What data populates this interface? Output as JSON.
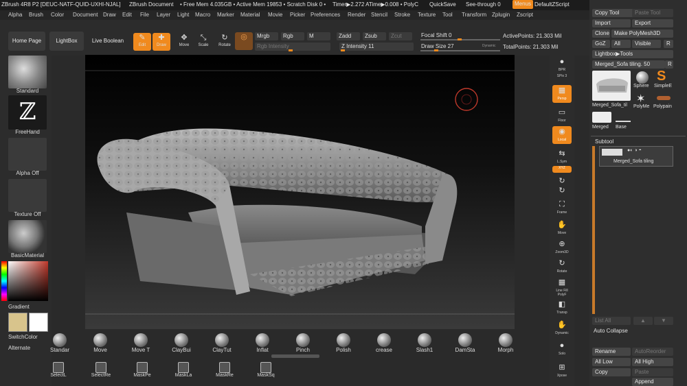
{
  "titlebar": {
    "app": "ZBrush 4R8 P2 [DEUC-NATF-QUID-UXHI-NJAL]",
    "doc": "ZBrush Document",
    "mem": "• Free Mem 4.035GB • Active Mem 19853 • Scratch Disk 0 •",
    "timer": "Timer▶2.272 ATime▶0.008 • PolyC",
    "quicksave": "QuickSave",
    "seethrough": "See-through  0",
    "menus": "Menus",
    "script": "DefaultZScript"
  },
  "menubar": [
    "Alpha",
    "Brush",
    "Color",
    "Document",
    "Draw",
    "Edit",
    "File",
    "Layer",
    "Light",
    "Macro",
    "Marker",
    "Material",
    "Movie",
    "Picker",
    "Preferences",
    "Render",
    "Stencil",
    "Stroke",
    "Texture",
    "Tool",
    "Transform",
    "Zplugin",
    "Zscript"
  ],
  "topshelf": {
    "home": "Home Page",
    "lightbox": "LightBox",
    "liveboolean": "Live Boolean",
    "tools": [
      {
        "label": "Edit",
        "icon": "✎"
      },
      {
        "label": "Draw",
        "icon": "✚"
      },
      {
        "label": "Move",
        "icon": "✥"
      },
      {
        "label": "Scale",
        "icon": "⤡"
      },
      {
        "label": "Rotate",
        "icon": "↻"
      }
    ],
    "mrgb": "Mrgb",
    "rgb": "Rgb",
    "m": "M",
    "zadd": "Zadd",
    "zsub": "Zsub",
    "zcut": "Zcut",
    "rgb_intensity": "Rgb Intensity",
    "z_intensity": "Z Intensity 11",
    "focal_shift": "Focal Shift 0",
    "draw_size": "Draw Size 27",
    "dynamic": "Dynamic",
    "active_points": "ActivePoints: 21.303 Mil",
    "total_points": "TotalPoints: 21.303 Mil"
  },
  "leftpanel": {
    "standard": "Standard",
    "freehand": "FreeHand",
    "alpha_off": "Alpha Off",
    "texture_off": "Texture Off",
    "basic_material": "BasicMaterial",
    "gradient": "Gradient",
    "switch_color": "SwitchColor",
    "alternate": "Alternate"
  },
  "rightshelf": [
    {
      "label": "BPR",
      "icon": "●",
      "active": false
    },
    {
      "label": "SPix 3",
      "icon": "",
      "active": false
    },
    {
      "label": "Persp",
      "icon": "▦",
      "active": true
    },
    {
      "label": "Floor",
      "icon": "▭",
      "active": false
    },
    {
      "label": "Local",
      "icon": "◉",
      "active": true
    },
    {
      "label": "L.Sym",
      "icon": "⇆",
      "active": false
    },
    {
      "label": "XYZ",
      "icon": "",
      "active": true
    },
    {
      "label": "",
      "icon": "↻",
      "active": false
    },
    {
      "label": "",
      "icon": "↻",
      "active": false
    },
    {
      "label": "Frame",
      "icon": "⛶",
      "active": false
    },
    {
      "label": "Move",
      "icon": "✋",
      "active": false
    },
    {
      "label": "Zoom3D",
      "icon": "⊕",
      "active": false
    },
    {
      "label": "Rotate",
      "icon": "↻",
      "active": false
    },
    {
      "label": "Line Fill PolyF",
      "icon": "▦",
      "active": false
    },
    {
      "label": "Transp",
      "icon": "◧",
      "active": false
    },
    {
      "label": "Dynamic",
      "icon": "✋",
      "active": false
    },
    {
      "label": "Solo",
      "icon": "●",
      "active": false
    },
    {
      "label": "Xpose",
      "icon": "⊞",
      "active": false
    }
  ],
  "rightpanel": {
    "copy_tool": "Copy Tool",
    "paste_tool": "Paste Tool",
    "import": "Import",
    "export": "Export",
    "clone": "Clone",
    "make_polymesh": "Make PolyMesh3D",
    "goz": "GoZ",
    "all": "All",
    "visible": "Visible",
    "r": "R",
    "lightbox_tools": "Lightbox▶Tools",
    "merged_tiling": "Merged_Sofa tiling. 50",
    "tools": [
      "Merged_Sofa_til",
      "Sphere",
      "SimpleE",
      "PolyMe",
      "Polypain",
      "Merged",
      "Base"
    ],
    "subtool_header": "Subtool",
    "subtool_item": "Merged_Sofa tiling",
    "list_all": "List All",
    "auto_collapse": "Auto Collapse",
    "rename": "Rename",
    "autoreorder": "AutoReorder",
    "all_low": "All Low",
    "all_high": "All High",
    "copy": "Copy",
    "paste": "Paste",
    "append": "Append"
  },
  "bottomshelf": {
    "brushes": [
      "Standar",
      "Move",
      "Move T",
      "ClayBui",
      "ClayTut",
      "Inflat",
      "Pinch",
      "Polish",
      "crease",
      "Slash1",
      "DamSta",
      "Morph"
    ],
    "masks": [
      "SelectL",
      "SelectRe",
      "MaskPe",
      "MaskLa",
      "MaskRe",
      "MaskSq"
    ]
  },
  "colors": {
    "accent": "#f08a1e",
    "panel": "#2c2c2c",
    "viewport": "#000000"
  }
}
